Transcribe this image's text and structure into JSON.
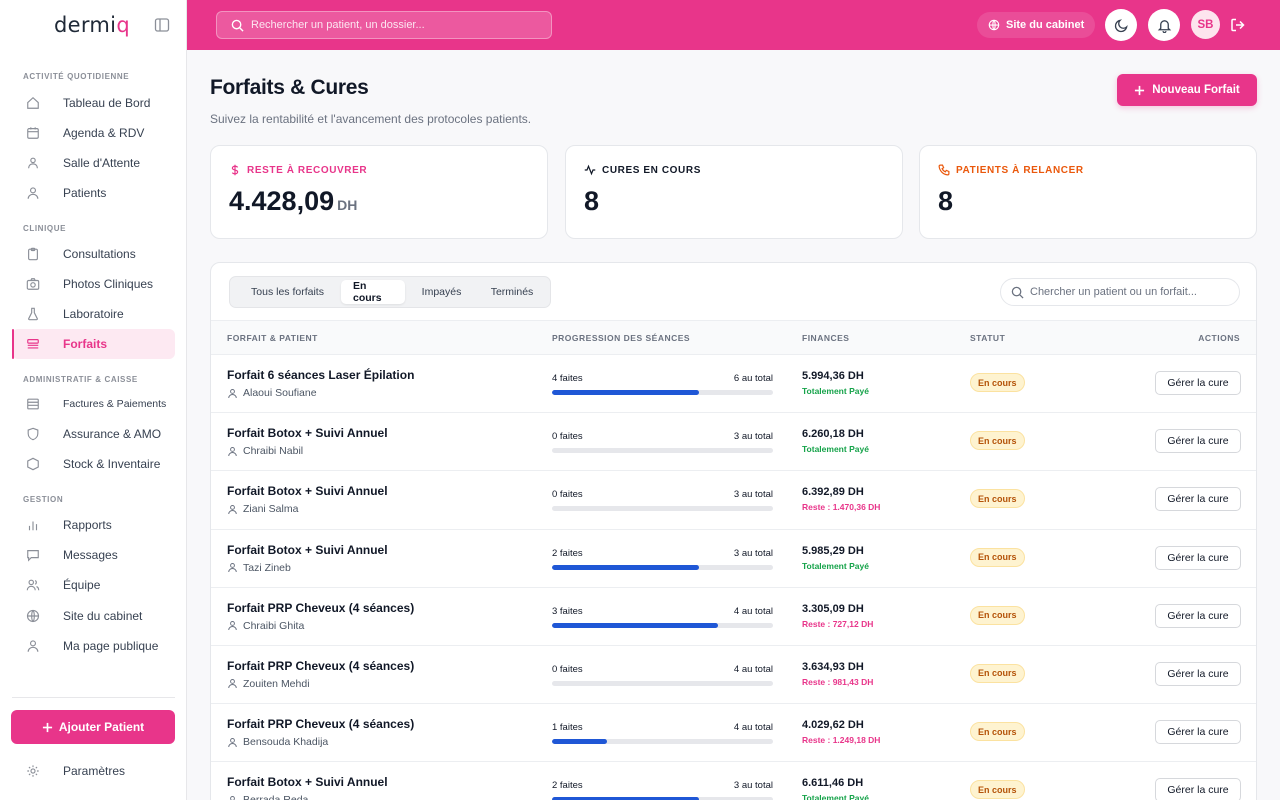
{
  "brand": {
    "text_a": "dermi",
    "text_b": "q"
  },
  "sidebar": {
    "sections": [
      {
        "title": "ACTIVITÉ QUOTIDIENNE"
      },
      {
        "title": "CLINIQUE"
      },
      {
        "title": "ADMINISTRATIF & CAISSE"
      },
      {
        "title": "GESTION"
      }
    ],
    "items": [
      {
        "label": "Tableau de Bord",
        "icon": "home-icon"
      },
      {
        "label": "Agenda & RDV",
        "icon": "calendar-icon"
      },
      {
        "label": "Salle d'Attente",
        "icon": "waiting-room-icon"
      },
      {
        "label": "Patients",
        "icon": "user-icon"
      },
      {
        "label": "Consultations",
        "icon": "clipboard-icon"
      },
      {
        "label": "Photos Cliniques",
        "icon": "camera-icon"
      },
      {
        "label": "Laboratoire",
        "icon": "flask-icon"
      },
      {
        "label": "Forfaits",
        "icon": "layers-icon",
        "active": true
      },
      {
        "label": "Factures & Paiements",
        "icon": "invoice-icon"
      },
      {
        "label": "Assurance & AMO",
        "icon": "shield-icon"
      },
      {
        "label": "Stock & Inventaire",
        "icon": "box-icon"
      },
      {
        "label": "Rapports",
        "icon": "bar-chart-icon"
      },
      {
        "label": "Messages",
        "icon": "message-icon"
      },
      {
        "label": "Équipe",
        "icon": "team-icon"
      },
      {
        "label": "Site du cabinet",
        "icon": "globe-icon"
      },
      {
        "label": "Ma page publique",
        "icon": "user-icon"
      },
      {
        "label": "Paramètres",
        "icon": "gear-icon"
      }
    ],
    "add_patient": "Ajouter Patient"
  },
  "topbar": {
    "search_placeholder": "Rechercher un patient, un dossier...",
    "site_label": "Site du cabinet",
    "avatar_initials": "SB"
  },
  "header": {
    "title": "Forfaits & Cures",
    "subtitle": "Suivez la rentabilité et l'avancement des protocoles patients.",
    "new_button": "Nouveau Forfait"
  },
  "stats": [
    {
      "label": "RESTE À RECOUVRER",
      "value": "4.428,09",
      "unit": "DH",
      "color": "#e8358a",
      "icon": "dollar-icon"
    },
    {
      "label": "CURES EN COURS",
      "value": "8",
      "unit": "",
      "color": "#111827",
      "icon": "activity-icon"
    },
    {
      "label": "PATIENTS À RELANCER",
      "value": "8",
      "unit": "",
      "color": "#ea580c",
      "icon": "phone-icon"
    }
  ],
  "tabs": [
    "Tous les forfaits",
    "En cours",
    "Impayés",
    "Terminés"
  ],
  "active_tab": "En cours",
  "table_search_placeholder": "Chercher un patient ou un forfait...",
  "columns": [
    "FORFAIT & PATIENT",
    "PROGRESSION DES SÉANCES",
    "FINANCES",
    "STATUT",
    "ACTIONS"
  ],
  "rows": [
    {
      "name": "Forfait 6 séances Laser Épilation",
      "patient": "Alaoui Soufiane",
      "done": "4 faites",
      "total": "6 au total",
      "progress": 0.667,
      "amount": "5.994,36 DH",
      "fin_status": "Totalement Payé",
      "paid": true,
      "status": "En cours",
      "action": "Gérer la cure"
    },
    {
      "name": "Forfait Botox + Suivi Annuel",
      "patient": "Chraibi Nabil",
      "done": "0 faites",
      "total": "3 au total",
      "progress": 0,
      "amount": "6.260,18 DH",
      "fin_status": "Totalement Payé",
      "paid": true,
      "status": "En cours",
      "action": "Gérer la cure"
    },
    {
      "name": "Forfait Botox + Suivi Annuel",
      "patient": "Ziani Salma",
      "done": "0 faites",
      "total": "3 au total",
      "progress": 0,
      "amount": "6.392,89 DH",
      "fin_status": "Reste : 1.470,36 DH",
      "paid": false,
      "status": "En cours",
      "action": "Gérer la cure"
    },
    {
      "name": "Forfait Botox + Suivi Annuel",
      "patient": "Tazi Zineb",
      "done": "2 faites",
      "total": "3 au total",
      "progress": 0.667,
      "amount": "5.985,29 DH",
      "fin_status": "Totalement Payé",
      "paid": true,
      "status": "En cours",
      "action": "Gérer la cure"
    },
    {
      "name": "Forfait PRP Cheveux (4 séances)",
      "patient": "Chraibi Ghita",
      "done": "3 faites",
      "total": "4 au total",
      "progress": 0.75,
      "amount": "3.305,09 DH",
      "fin_status": "Reste : 727,12 DH",
      "paid": false,
      "status": "En cours",
      "action": "Gérer la cure"
    },
    {
      "name": "Forfait PRP Cheveux (4 séances)",
      "patient": "Zouiten Mehdi",
      "done": "0 faites",
      "total": "4 au total",
      "progress": 0,
      "amount": "3.634,93 DH",
      "fin_status": "Reste : 981,43 DH",
      "paid": false,
      "status": "En cours",
      "action": "Gérer la cure"
    },
    {
      "name": "Forfait PRP Cheveux (4 séances)",
      "patient": "Bensouda Khadija",
      "done": "1 faites",
      "total": "4 au total",
      "progress": 0.25,
      "amount": "4.029,62 DH",
      "fin_status": "Reste : 1.249,18 DH",
      "paid": false,
      "status": "En cours",
      "action": "Gérer la cure"
    },
    {
      "name": "Forfait Botox + Suivi Annuel",
      "patient": "Berrada Reda",
      "done": "2 faites",
      "total": "3 au total",
      "progress": 0.667,
      "amount": "6.611,46 DH",
      "fin_status": "Totalement Payé",
      "paid": true,
      "status": "En cours",
      "action": "Gérer la cure"
    }
  ]
}
